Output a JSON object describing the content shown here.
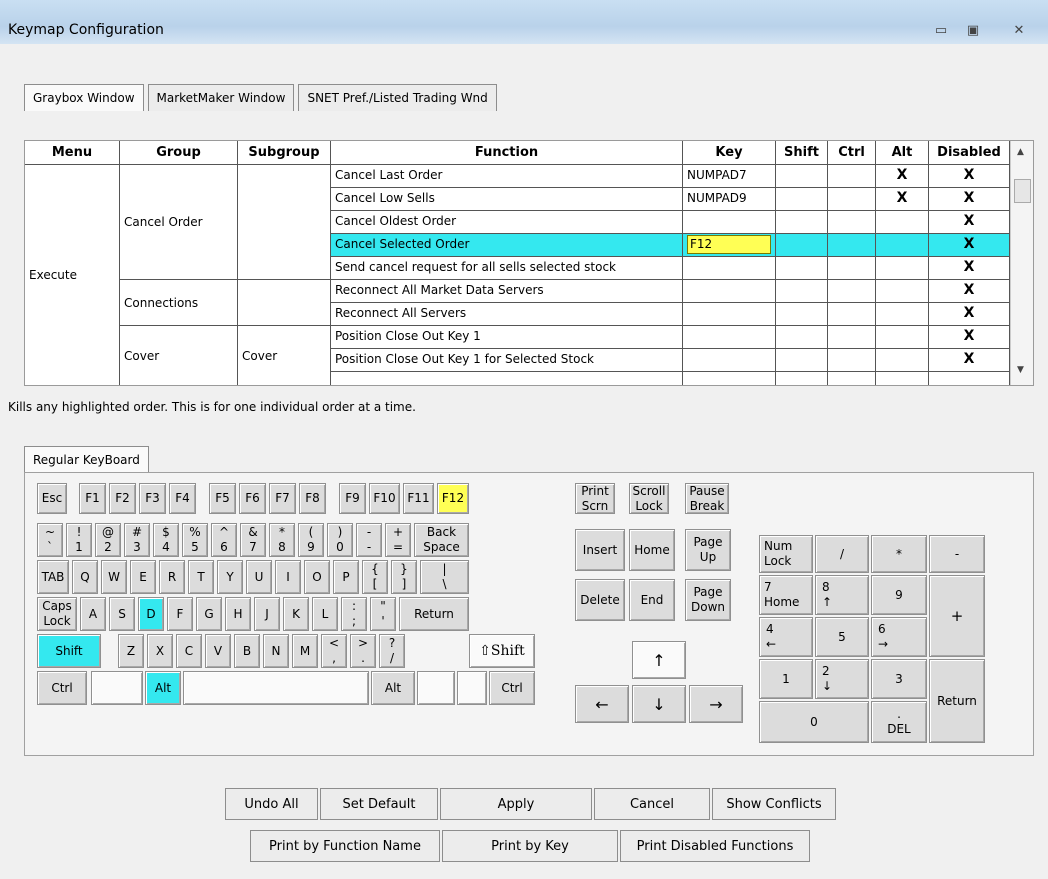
{
  "window": {
    "title": "Keymap Configuration"
  },
  "tabs": [
    "Graybox Window",
    "MarketMaker Window",
    "SNET Pref./Listed Trading Wnd"
  ],
  "grid": {
    "headers": [
      "Menu",
      "Group",
      "Subgroup",
      "Function",
      "Key",
      "Shift",
      "Ctrl",
      "Alt",
      "Disabled"
    ],
    "menu": "Execute",
    "groups": [
      "Cancel Order",
      "Connections",
      "Cover"
    ],
    "subgroups": [
      "Cover"
    ],
    "rows": [
      {
        "function": "Cancel Last Order",
        "key": "NUMPAD7",
        "shift": "",
        "ctrl": "",
        "alt": "X",
        "disabled": "X"
      },
      {
        "function": "Cancel Low Sells",
        "key": "NUMPAD9",
        "shift": "",
        "ctrl": "",
        "alt": "X",
        "disabled": "X"
      },
      {
        "function": "Cancel Oldest Order",
        "key": "",
        "shift": "",
        "ctrl": "",
        "alt": "",
        "disabled": "X"
      },
      {
        "function": "Cancel Selected Order",
        "key": "F12",
        "shift": "",
        "ctrl": "",
        "alt": "",
        "disabled": "X"
      },
      {
        "function": "Send cancel request for all sells selected stock",
        "key": "",
        "shift": "",
        "ctrl": "",
        "alt": "",
        "disabled": "X"
      },
      {
        "function": "Reconnect All Market Data Servers",
        "key": "",
        "shift": "",
        "ctrl": "",
        "alt": "",
        "disabled": "X"
      },
      {
        "function": "Reconnect All Servers",
        "key": "",
        "shift": "",
        "ctrl": "",
        "alt": "",
        "disabled": "X"
      },
      {
        "function": "Position Close Out Key 1",
        "key": "",
        "shift": "",
        "ctrl": "",
        "alt": "",
        "disabled": "X"
      },
      {
        "function": "Position Close Out Key 1 for Selected Stock",
        "key": "",
        "shift": "",
        "ctrl": "",
        "alt": "",
        "disabled": "X"
      }
    ]
  },
  "description": "Kills any highlighted order.  This is for one individual order at a time.",
  "keyboard_tab": "Regular KeyBoard",
  "keys": {
    "esc": "Esc",
    "f1": "F1",
    "f2": "F2",
    "f3": "F3",
    "f4": "F4",
    "f5": "F5",
    "f6": "F6",
    "f7": "F7",
    "f8": "F8",
    "f9": "F9",
    "f10": "F10",
    "f11": "F11",
    "f12": "F12",
    "print_a": "Print",
    "print_b": "Scrn",
    "scroll_a": "Scroll",
    "scroll_b": "Lock",
    "pause_a": "Pause",
    "pause_b": "Break",
    "row1": [
      [
        "~",
        "`"
      ],
      [
        "!",
        "1"
      ],
      [
        "@",
        "2"
      ],
      [
        "#",
        "3"
      ],
      [
        "$",
        "4"
      ],
      [
        "%",
        "5"
      ],
      [
        "^",
        "6"
      ],
      [
        "&",
        "7"
      ],
      [
        "*",
        "8"
      ],
      [
        "(",
        "9"
      ],
      [
        ")",
        "0"
      ],
      [
        "-",
        "-"
      ],
      [
        "+",
        "="
      ]
    ],
    "back_a": "Back",
    "back_b": "Space",
    "tab": "TAB",
    "row2": [
      "Q",
      "W",
      "E",
      "R",
      "T",
      "Y",
      "U",
      "I",
      "O",
      "P"
    ],
    "row2b": [
      [
        "{",
        "["
      ],
      [
        "}",
        "]"
      ],
      [
        "|",
        "\\"
      ]
    ],
    "caps_a": "Caps",
    "caps_b": "Lock",
    "row3": [
      "A",
      "S",
      "D",
      "F",
      "G",
      "H",
      "J",
      "K",
      "L"
    ],
    "row3b": [
      [
        ":",
        ";"
      ],
      [
        "\"",
        "'"
      ]
    ],
    "return": "Return",
    "shift": "Shift",
    "row4": [
      "Z",
      "X",
      "C",
      "V",
      "B",
      "N",
      "M"
    ],
    "row4b": [
      [
        "<",
        ","
      ],
      [
        ">",
        "."
      ],
      [
        "?",
        "/"
      ]
    ],
    "rshift": "⇧Shift",
    "ctrl": "Ctrl",
    "alt": "Alt",
    "ralt": "Alt",
    "rctrl": "Ctrl",
    "insert": "Insert",
    "home": "Home",
    "pgup_a": "Page",
    "pgup_b": "Up",
    "delete": "Delete",
    "end": "End",
    "pgdn_a": "Page",
    "pgdn_b": "Down",
    "up": "↑",
    "left": "←",
    "down": "↓",
    "right": "→",
    "numlock_a": "Num",
    "numlock_b": "Lock",
    "nslash": "/",
    "nstar": "*",
    "nminus": "-",
    "n7a": "7",
    "n7b": "Home",
    "n8a": "8",
    "n8b": "↑",
    "n9": "9",
    "nplus": "+",
    "n4a": "4",
    "n4b": "←",
    "n5": "5",
    "n6a": "6",
    "n6b": "→",
    "n1": "1",
    "n2a": "2",
    "n2b": "↓",
    "n3": "3",
    "nreturn": "Return",
    "n0": "0",
    "ndel_a": ".",
    "ndel_b": "DEL"
  },
  "buttons": {
    "undo_all": "Undo All",
    "set_default": "Set Default",
    "apply": "Apply",
    "cancel": "Cancel",
    "show_conflicts": "Show Conflicts",
    "print_by_function": "Print by Function Name",
    "print_by_key": "Print by Key",
    "print_disabled": "Print Disabled Functions"
  },
  "colors": {
    "highlight": "#34e8ef",
    "key_selected": "#ffff55"
  }
}
